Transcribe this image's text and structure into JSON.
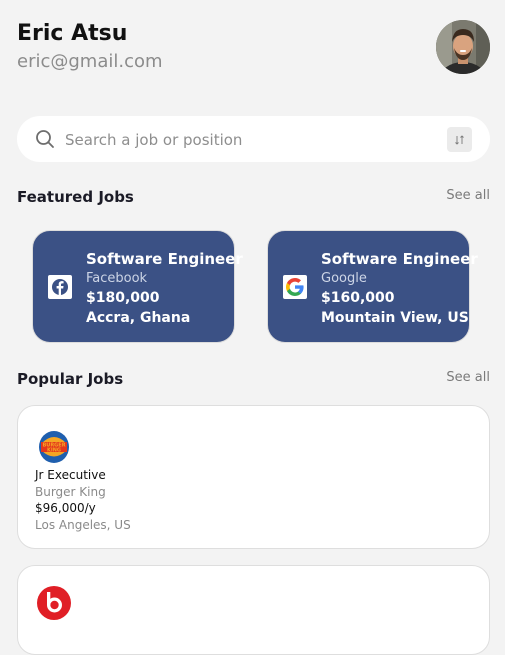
{
  "user": {
    "name": "Eric Atsu",
    "email": "eric@gmail.com"
  },
  "search": {
    "placeholder": "Search a job or position",
    "value": ""
  },
  "featured": {
    "title": "Featured Jobs",
    "see_all": "See all",
    "jobs": [
      {
        "title": "Software Engineer",
        "company": "Facebook",
        "salary": "$180,000",
        "location": "Accra, Ghana",
        "logo": "facebook-icon"
      },
      {
        "title": "Software Engineer",
        "company": "Google",
        "salary": "$160,000",
        "location": "Mountain View, US",
        "logo": "google-icon"
      }
    ]
  },
  "popular": {
    "title": "Popular Jobs",
    "see_all": "See all",
    "jobs": [
      {
        "title": "Jr Executive",
        "company": "Burger King",
        "salary": "$96,000/y",
        "location": "Los Angeles, US",
        "logo": "burger-king-icon",
        "logo_text_top": "BURGER",
        "logo_text_bottom": "KING"
      },
      {
        "logo": "beats-icon"
      }
    ]
  },
  "colors": {
    "background": "#f3f3f3",
    "featured_card": "#3b5185",
    "facebook": "#3b5185",
    "beats": "#e01f26"
  }
}
